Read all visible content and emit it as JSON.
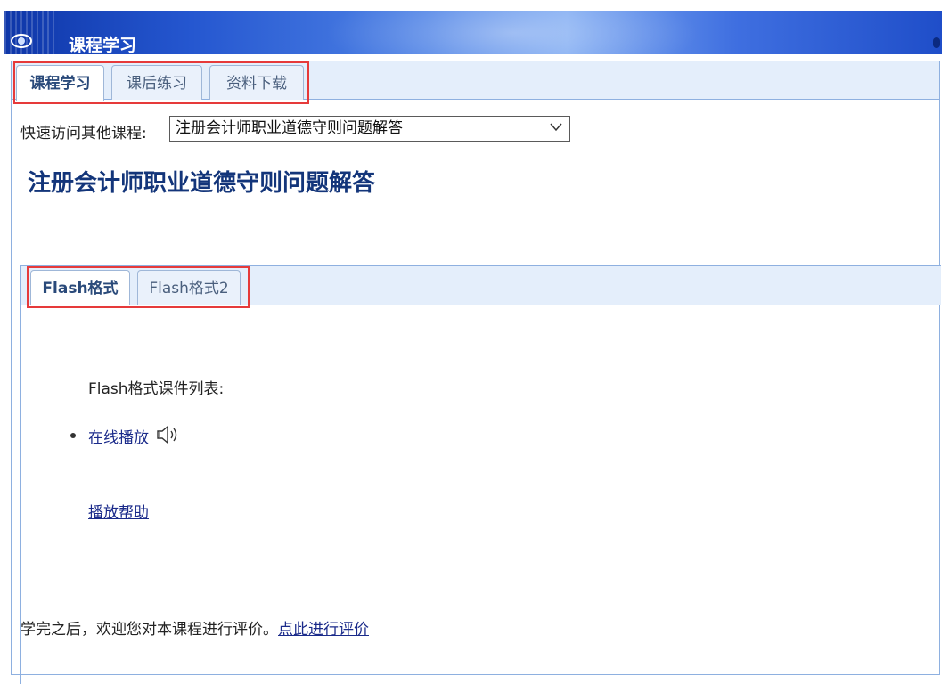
{
  "header": {
    "title": "课程学习"
  },
  "main_tabs": [
    {
      "label": "课程学习",
      "active": true
    },
    {
      "label": "课后练习",
      "active": false
    },
    {
      "label": "资料下载",
      "active": false
    }
  ],
  "quick_access": {
    "label": "快速访问其他课程:",
    "selected": "注册会计师职业道德守则问题解答"
  },
  "course_title": "注册会计师职业道德守则问题解答",
  "format_tabs": [
    {
      "label": "Flash格式",
      "active": true
    },
    {
      "label": "Flash格式2",
      "active": false
    }
  ],
  "content": {
    "list_label": "Flash格式课件列表:",
    "items": [
      {
        "label": "在线播放",
        "icon": "speaker-icon"
      }
    ],
    "help_link": "播放帮助",
    "evaluation_text": "学完之后，欢迎您对本课程进行评价。",
    "evaluation_link": "点此进行评价"
  },
  "colors": {
    "header_blue": "#2557d0",
    "tab_bar": "#e4eefb",
    "title_blue": "#13357a",
    "link": "#1a2a8a",
    "highlight_box": "#e63a3a"
  }
}
